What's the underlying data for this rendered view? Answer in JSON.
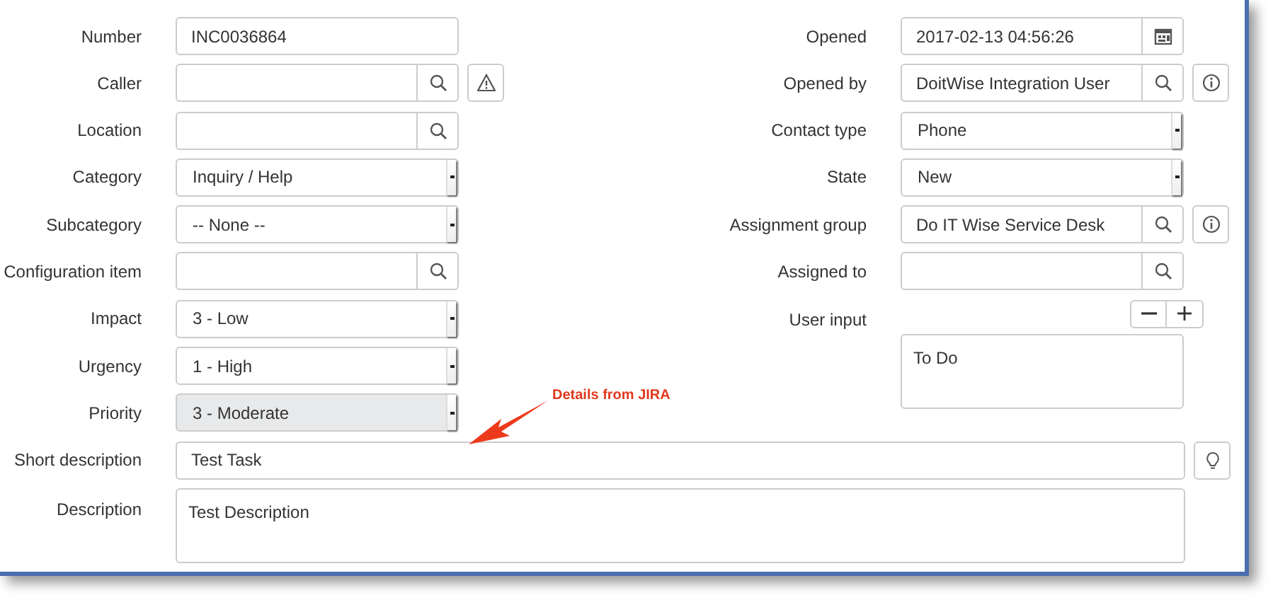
{
  "left_fields": [
    {
      "label": "Number",
      "kind": "text",
      "value": "INC0036864",
      "readonly": false
    },
    {
      "label": "Caller",
      "kind": "lookup",
      "readonly": false,
      "side_button": {
        "kind": "warning"
      }
    },
    {
      "label": "Location",
      "kind": "lookup",
      "readonly": false
    },
    {
      "label": "Category",
      "kind": "select",
      "value": "Inquiry / Help",
      "readonly": false
    },
    {
      "label": "Subcategory",
      "kind": "select",
      "value": "-- None --",
      "readonly": false
    },
    {
      "label": "Configuration item",
      "kind": "lookup",
      "readonly": false
    },
    {
      "label": "Impact",
      "kind": "select",
      "value": "3 - Low",
      "readonly": false
    },
    {
      "label": "Urgency",
      "kind": "select",
      "value": "1 - High",
      "readonly": false
    },
    {
      "label": "Priority",
      "kind": "select",
      "value": "3 - Moderate",
      "readonly": true
    }
  ],
  "right_fields": [
    {
      "label": "Opened",
      "kind": "date",
      "value": "2017-02-13 04:56:26",
      "readonly": false
    },
    {
      "label": "Opened by",
      "kind": "lookup",
      "value": "DoitWise Integration User",
      "readonly": false,
      "side_button": {
        "kind": "info"
      }
    },
    {
      "label": "Contact type",
      "kind": "select",
      "value": "Phone",
      "readonly": false
    },
    {
      "label": "State",
      "kind": "select",
      "value": "New",
      "readonly": false
    },
    {
      "label": "Assignment group",
      "kind": "lookup",
      "value": "Do IT Wise Service Desk",
      "readonly": false,
      "side_button": {
        "kind": "info"
      }
    },
    {
      "label": "Assigned to",
      "kind": "lookup",
      "readonly": false
    }
  ],
  "user_input": {
    "label": "User input",
    "value": "To Do"
  },
  "short_description": {
    "label": "Short description",
    "value": "Test Task",
    "side_button": {
      "kind": "hint"
    }
  },
  "description": {
    "label": "Description",
    "value": "Test Description"
  },
  "annotation": {
    "text": "Details from JIRA"
  }
}
